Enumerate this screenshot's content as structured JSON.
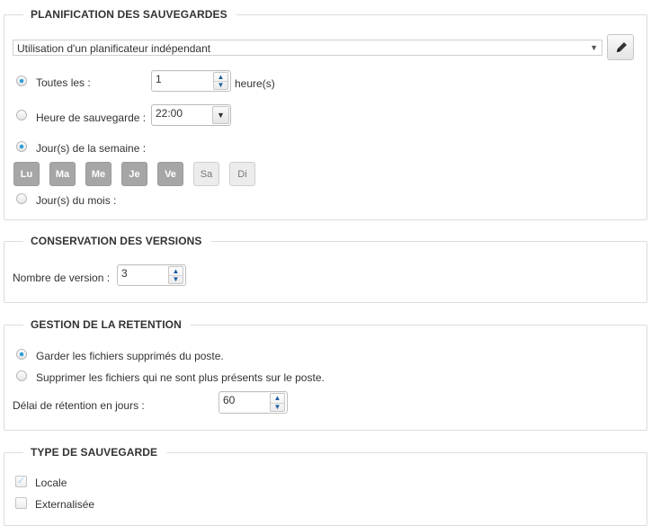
{
  "planning": {
    "title": "PLANIFICATION DES SAUVEGARDES",
    "scheduler_value": "Utilisation d'un planificateur indépendant",
    "every_label": "Toutes les :",
    "every_value": "1",
    "every_unit": "heure(s)",
    "time_label": "Heure de sauvegarde :",
    "time_value": "22:00",
    "weekdays_label": "Jour(s) de la semaine :",
    "days": [
      {
        "label": "Lu",
        "selected": true
      },
      {
        "label": "Ma",
        "selected": true
      },
      {
        "label": "Me",
        "selected": true
      },
      {
        "label": "Je",
        "selected": true
      },
      {
        "label": "Ve",
        "selected": true
      },
      {
        "label": "Sa",
        "selected": false
      },
      {
        "label": "Di",
        "selected": false
      }
    ],
    "monthdays_label": "Jour(s) du mois :"
  },
  "versions": {
    "title": "CONSERVATION DES VERSIONS",
    "count_label": "Nombre de version :",
    "count_value": "3"
  },
  "retention": {
    "title": "GESTION DE LA RETENTION",
    "keep_label": "Garder les fichiers supprimés du poste.",
    "delete_label": "Supprimer les fichiers qui ne sont plus présents sur le poste.",
    "delay_label": "Délai de rétention en jours :",
    "delay_value": "60"
  },
  "backup_type": {
    "title": "TYPE DE SAUVEGARDE",
    "local_label": "Locale",
    "local_checked": true,
    "external_label": "Externalisée",
    "external_checked": false
  },
  "colors": {
    "accent": "#2a9bd8",
    "day_selected": "#a6a6a6",
    "day_unselected": "#ececec",
    "border": "#dcdcdc"
  }
}
